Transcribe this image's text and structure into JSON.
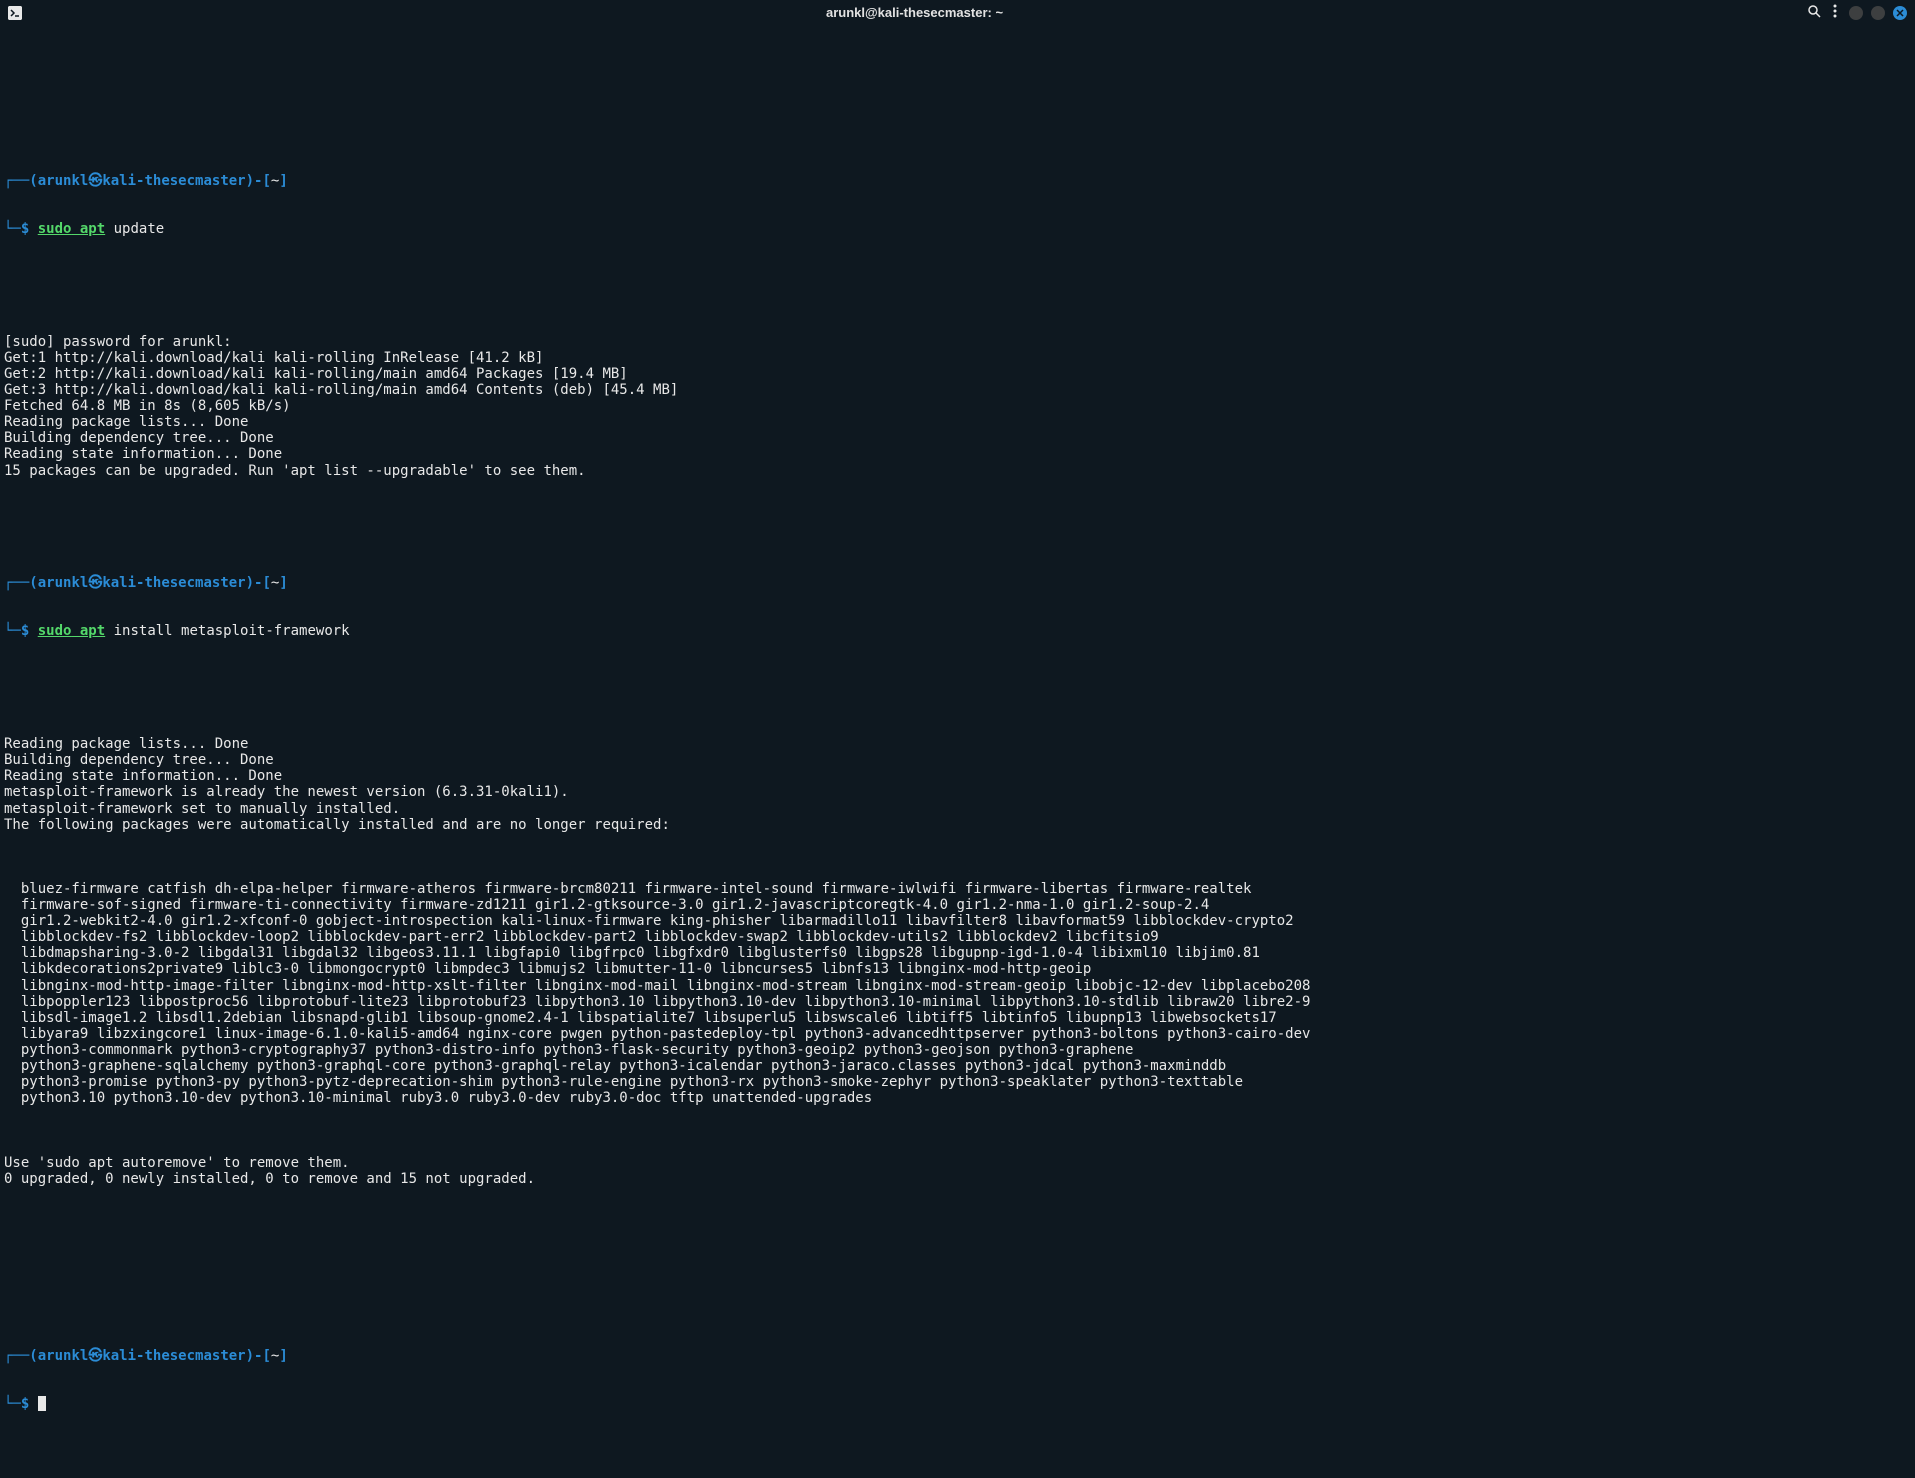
{
  "window": {
    "title": "arunkl@kali-thesecmaster: ~"
  },
  "prompt": {
    "user": "arunkl",
    "at": "㉿",
    "host": "kali-thesecmaster",
    "path": "~",
    "symbol": "$",
    "open_paren": "(",
    "close_paren": ")",
    "dash_open": "-[",
    "dash_close": "]",
    "corner_top": "┌──",
    "corner_bottom": "└─"
  },
  "commands": {
    "c1_sudo": "sudo",
    "c1_rest": " apt update",
    "c2_sudo": "sudo",
    "c2_apt": " apt",
    "c2_rest": " install metasploit-framework"
  },
  "output_block1": [
    "[sudo] password for arunkl:",
    "Get:1 http://kali.download/kali kali-rolling InRelease [41.2 kB]",
    "Get:2 http://kali.download/kali kali-rolling/main amd64 Packages [19.4 MB]",
    "Get:3 http://kali.download/kali kali-rolling/main amd64 Contents (deb) [45.4 MB]",
    "Fetched 64.8 MB in 8s (8,605 kB/s)",
    "Reading package lists... Done",
    "Building dependency tree... Done",
    "Reading state information... Done",
    "15 packages can be upgraded. Run 'apt list --upgradable' to see them."
  ],
  "output_block2_head": [
    "Reading package lists... Done",
    "Building dependency tree... Done",
    "Reading state information... Done",
    "metasploit-framework is already the newest version (6.3.31-0kali1).",
    "metasploit-framework set to manually installed.",
    "The following packages were automatically installed and are no longer required:"
  ],
  "output_block2_packages": [
    "  bluez-firmware catfish dh-elpa-helper firmware-atheros firmware-brcm80211 firmware-intel-sound firmware-iwlwifi firmware-libertas firmware-realtek",
    "  firmware-sof-signed firmware-ti-connectivity firmware-zd1211 gir1.2-gtksource-3.0 gir1.2-javascriptcoregtk-4.0 gir1.2-nma-1.0 gir1.2-soup-2.4",
    "  gir1.2-webkit2-4.0 gir1.2-xfconf-0 gobject-introspection kali-linux-firmware king-phisher libarmadillo11 libavfilter8 libavformat59 libblockdev-crypto2",
    "  libblockdev-fs2 libblockdev-loop2 libblockdev-part-err2 libblockdev-part2 libblockdev-swap2 libblockdev-utils2 libblockdev2 libcfitsio9",
    "  libdmapsharing-3.0-2 libgdal31 libgdal32 libgeos3.11.1 libgfapi0 libgfrpc0 libgfxdr0 libglusterfs0 libgps28 libgupnp-igd-1.0-4 libixml10 libjim0.81",
    "  libkdecorations2private9 liblc3-0 libmongocrypt0 libmpdec3 libmujs2 libmutter-11-0 libncurses5 libnfs13 libnginx-mod-http-geoip",
    "  libnginx-mod-http-image-filter libnginx-mod-http-xslt-filter libnginx-mod-mail libnginx-mod-stream libnginx-mod-stream-geoip libobjc-12-dev libplacebo208",
    "  libpoppler123 libpostproc56 libprotobuf-lite23 libprotobuf23 libpython3.10 libpython3.10-dev libpython3.10-minimal libpython3.10-stdlib libraw20 libre2-9",
    "  libsdl-image1.2 libsdl1.2debian libsnapd-glib1 libsoup-gnome2.4-1 libspatialite7 libsuperlu5 libswscale6 libtiff5 libtinfo5 libupnp13 libwebsockets17",
    "  libyara9 libzxingcore1 linux-image-6.1.0-kali5-amd64 nginx-core pwgen python-pastedeploy-tpl python3-advancedhttpserver python3-boltons python3-cairo-dev",
    "  python3-commonmark python3-cryptography37 python3-distro-info python3-flask-security python3-geoip2 python3-geojson python3-graphene",
    "  python3-graphene-sqlalchemy python3-graphql-core python3-graphql-relay python3-icalendar python3-jaraco.classes python3-jdcal python3-maxminddb",
    "  python3-promise python3-py python3-pytz-deprecation-shim python3-rule-engine python3-rx python3-smoke-zephyr python3-speaklater python3-texttable",
    "  python3.10 python3.10-dev python3.10-minimal ruby3.0 ruby3.0-dev ruby3.0-doc tftp unattended-upgrades"
  ],
  "output_block2_tail": [
    "Use 'sudo apt autoremove' to remove them.",
    "0 upgraded, 0 newly installed, 0 to remove and 15 not upgraded."
  ]
}
